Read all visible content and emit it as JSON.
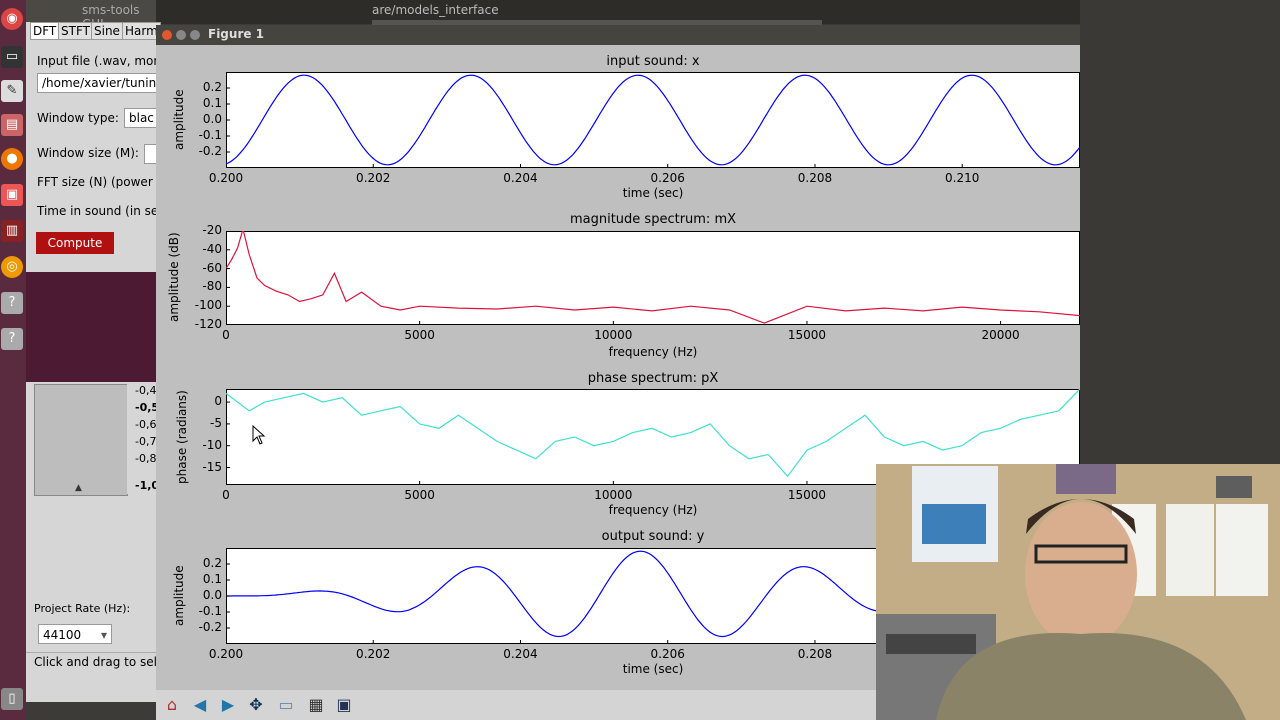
{
  "topbar": {
    "app_title": "sms-tools GUI",
    "bg_window_title": "are/models_interface"
  },
  "gui": {
    "tabs": [
      "DFT",
      "STFT",
      "Sine",
      "Harm"
    ],
    "input_label": "Input file (.wav, mon",
    "input_value": "/home/xavier/tunin",
    "window_type_label": "Window type:",
    "window_type_value": "blac",
    "window_size_label": "Window size (M):",
    "fft_label": "FFT size (N) (power",
    "time_label": "Time in sound (in se",
    "compute_label": "Compute"
  },
  "audacity": {
    "scale": [
      "-0,4",
      "-0,5",
      "-0,6",
      "-0,7",
      "-0,8",
      "-1,0"
    ],
    "project_rate_label": "Project Rate (Hz):",
    "project_rate_value": "44100",
    "status_text": "Click and drag to sel"
  },
  "figure": {
    "window_title": "Figure 1",
    "toolbar_icons": [
      "home-icon",
      "back-icon",
      "forward-icon",
      "pan-icon",
      "zoom-icon",
      "configure-icon",
      "save-icon"
    ]
  },
  "chart_data": [
    {
      "type": "line",
      "title": "input sound: x",
      "xlabel": "time (sec)",
      "ylabel": "amplitude",
      "xlim": [
        0.2,
        0.2116
      ],
      "ylim": [
        -0.3,
        0.3
      ],
      "x_ticks": [
        "0.200",
        "0.202",
        "0.204",
        "0.206",
        "0.208",
        "0.210"
      ],
      "y_ticks": [
        "0.2",
        "0.1",
        "0.0",
        "-0.1",
        "-0.2"
      ],
      "color": "#0000ff",
      "signal": {
        "form": "sine",
        "amplitude": 0.28,
        "period_sec": 0.002268,
        "peak_at_sec": 0.20106
      }
    },
    {
      "type": "line",
      "title": "magnitude spectrum: mX",
      "xlabel": "frequency (Hz)",
      "ylabel": "amplitude (dB)",
      "xlim": [
        0,
        22050
      ],
      "ylim": [
        -120,
        -20
      ],
      "x_ticks": [
        "0",
        "5000",
        "10000",
        "15000",
        "20000"
      ],
      "y_ticks": [
        "-20",
        "-40",
        "-60",
        "-80",
        "-100",
        "-120"
      ],
      "color": "#dc143c",
      "x": [
        0,
        150,
        300,
        440,
        600,
        800,
        1000,
        1300,
        1600,
        1900,
        2200,
        2500,
        2800,
        3100,
        3500,
        4000,
        4500,
        5000,
        6000,
        7000,
        8000,
        9000,
        10000,
        11000,
        12000,
        13000,
        13900,
        15000,
        16000,
        17000,
        18000,
        19000,
        20000,
        21000,
        22050
      ],
      "y": [
        -60,
        -50,
        -38,
        -18,
        -45,
        -70,
        -78,
        -84,
        -88,
        -95,
        -92,
        -88,
        -65,
        -95,
        -85,
        -100,
        -104,
        -100,
        -102,
        -103,
        -100,
        -104,
        -101,
        -105,
        -100,
        -104,
        -118,
        -100,
        -105,
        -102,
        -105,
        -101,
        -104,
        -106,
        -110
      ]
    },
    {
      "type": "line",
      "title": "phase spectrum: pX",
      "xlabel": "frequency (Hz)",
      "ylabel": "phase (radians)",
      "xlim": [
        0,
        22050
      ],
      "ylim": [
        -19,
        3
      ],
      "x_ticks": [
        "0",
        "5000",
        "10000",
        "15000"
      ],
      "y_ticks": [
        "0",
        "-5",
        "-10",
        "-15"
      ],
      "color": "#40e0d0",
      "x": [
        0,
        300,
        600,
        1000,
        1500,
        2000,
        2500,
        3000,
        3500,
        4000,
        4500,
        5000,
        5500,
        6000,
        6500,
        7000,
        7500,
        8000,
        8500,
        9000,
        9500,
        10000,
        10500,
        11000,
        11500,
        12000,
        12500,
        13000,
        13500,
        14000,
        14500,
        15000,
        15500,
        16000,
        16500,
        17000,
        17500,
        18000,
        18500,
        19000,
        19500,
        20000,
        20500,
        21000,
        21500,
        22050
      ],
      "y": [
        2,
        0,
        -2,
        0,
        1,
        2,
        0,
        1,
        -3,
        -2,
        -1,
        -5,
        -6,
        -3,
        -6,
        -9,
        -11,
        -13,
        -9,
        -8,
        -10,
        -9,
        -7,
        -6,
        -8,
        -7,
        -5,
        -10,
        -13,
        -12,
        -17,
        -11,
        -9,
        -6,
        -3,
        -8,
        -10,
        -9,
        -11,
        -10,
        -7,
        -6,
        -4,
        -3,
        -2,
        3
      ]
    },
    {
      "type": "line",
      "title": "output sound: y",
      "xlabel": "time (sec)",
      "ylabel": "amplitude",
      "xlim": [
        0.2,
        0.2116
      ],
      "ylim": [
        -0.3,
        0.3
      ],
      "x_ticks": [
        "0.200",
        "0.202",
        "0.204",
        "0.206",
        "0.208"
      ],
      "y_ticks": [
        "0.2",
        "0.1",
        "0.0",
        "-0.1",
        "-0.2"
      ],
      "color": "#0000ff",
      "signal": {
        "form": "windowed-sine",
        "amplitude": 0.28,
        "period_sec": 0.002268,
        "peak_at_sec": 0.20563,
        "window_center_sec": 0.20563,
        "window_halfwidth_sec": 0.0056
      }
    }
  ]
}
